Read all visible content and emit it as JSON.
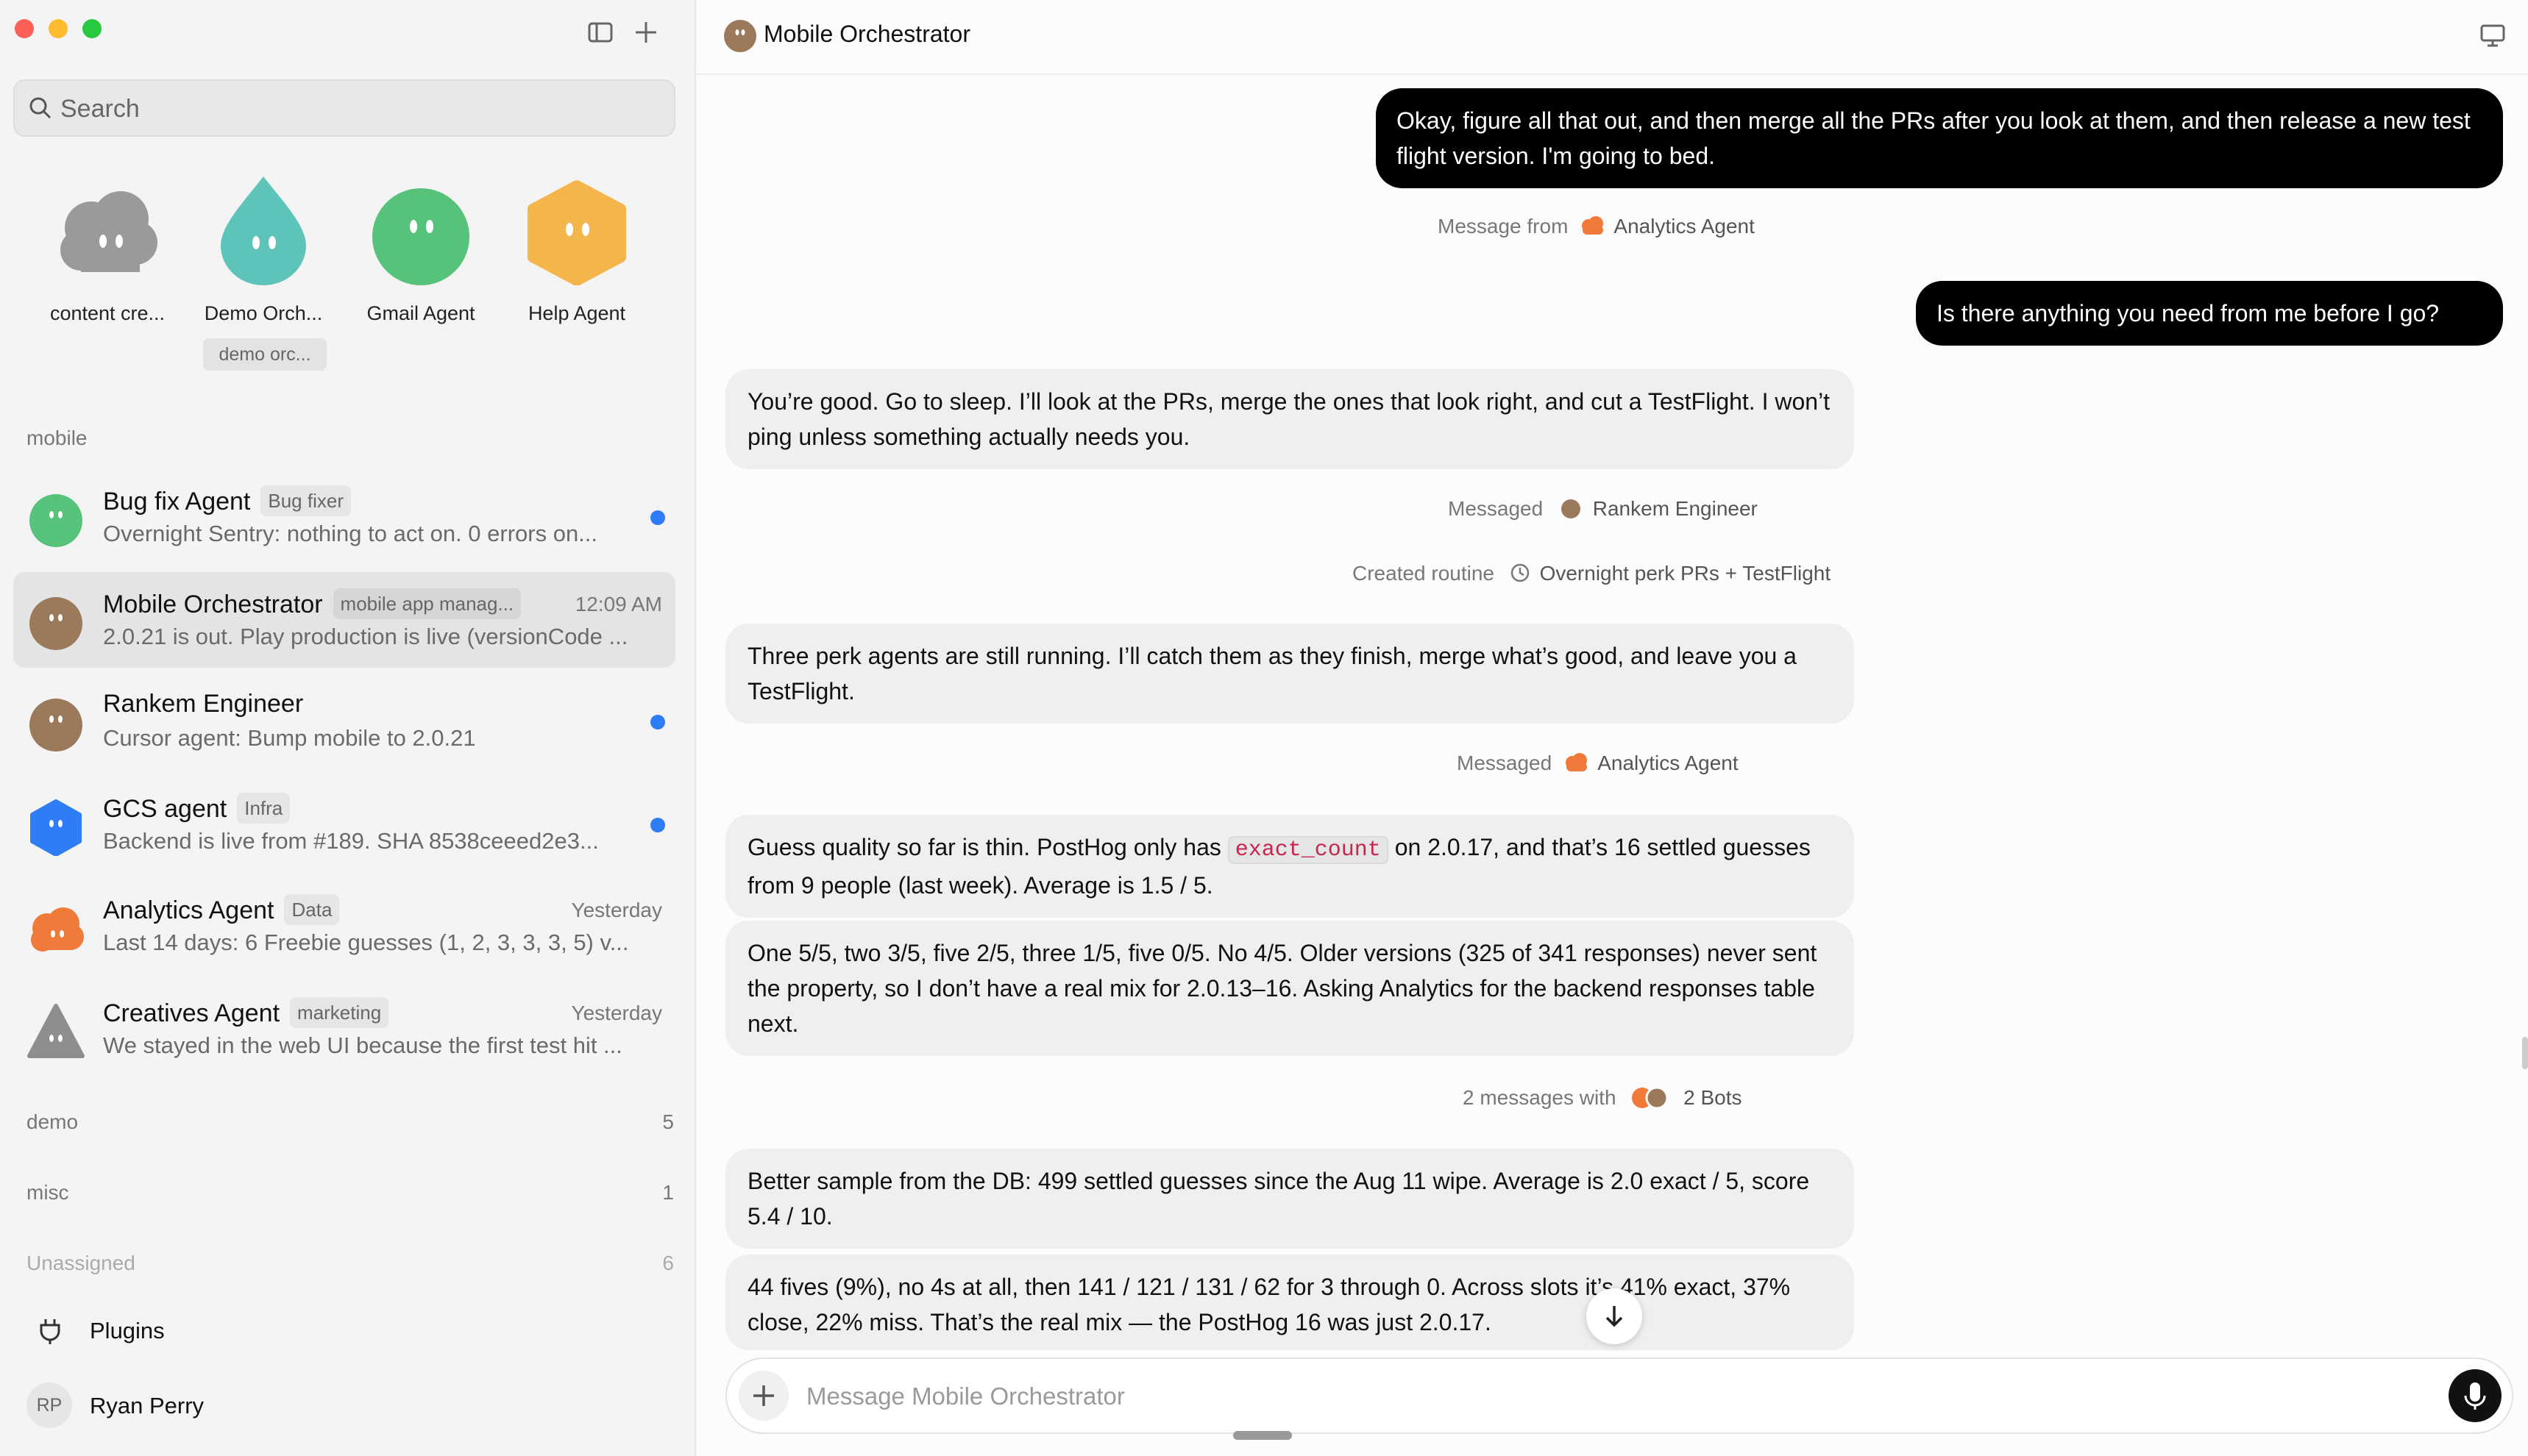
{
  "sidebar": {
    "search": {
      "placeholder": "Search"
    },
    "pinned": [
      {
        "label": "content cre...",
        "icon": "gray-cloud-icon",
        "color": "#9a9a9a"
      },
      {
        "label": "Demo Orch...",
        "sublabel": "demo orc...",
        "icon": "teal-drop-icon",
        "color": "#5ec3b8"
      },
      {
        "label": "Gmail Agent",
        "icon": "green-circle-icon",
        "color": "#56c27a"
      },
      {
        "label": "Help Agent",
        "icon": "orange-hexagon-icon",
        "color": "#f4b54a"
      }
    ],
    "sections": {
      "mobile": "mobile",
      "demo": {
        "label": "demo",
        "count": "5"
      },
      "misc": {
        "label": "misc",
        "count": "1"
      },
      "unassigned": {
        "label": "Unassigned",
        "count": "6"
      }
    },
    "conversations": [
      {
        "name": "Bug fix Agent",
        "tag": "Bug fixer",
        "preview": "Overnight Sentry: nothing to act on. 0 errors on...",
        "time": "",
        "unread": true
      },
      {
        "name": "Mobile Orchestrator",
        "tag": "mobile app manag...",
        "preview": "2.0.21 is out. Play production is live (versionCode ...",
        "time": "12:09 AM",
        "unread": false
      },
      {
        "name": "Rankem Engineer",
        "tag": "",
        "preview": "Cursor agent: Bump mobile to 2.0.21",
        "time": "",
        "unread": true
      },
      {
        "name": "GCS agent",
        "tag": "Infra",
        "preview": "Backend is live from #189. SHA 8538ceeed2e3...",
        "time": "",
        "unread": true
      },
      {
        "name": "Analytics Agent",
        "tag": "Data",
        "preview": "Last 14 days: 6 Freebie guesses (1, 2, 3, 3, 3, 5) v...",
        "time": "Yesterday",
        "unread": false
      },
      {
        "name": "Creatives Agent",
        "tag": "marketing",
        "preview": "We stayed in the web UI because the first test hit ...",
        "time": "Yesterday",
        "unread": false
      }
    ],
    "footer": {
      "plugins": "Plugins",
      "user_initials": "RP",
      "user_name": "Ryan Perry"
    }
  },
  "header": {
    "title": "Mobile Orchestrator"
  },
  "messages": {
    "user1": "Okay, figure all that out, and then merge all the PRs after you look at them, and then release a new test flight version. I'm going to bed.",
    "sys1_prefix": "Message from",
    "sys1_who": "Analytics Agent",
    "user2": "Is there anything you need from me before I go?",
    "bot1": "You’re good. Go to sleep. I’ll look at the PRs, merge the ones that look right, and cut a TestFlight. I won’t ping unless something actually needs you.",
    "sys2_prefix": "Messaged",
    "sys2_who": "Rankem Engineer",
    "sys3_prefix": "Created routine",
    "sys3_who": "Overnight perk PRs + TestFlight",
    "bot2": "Three perk agents are still running. I’ll catch them as they finish, merge what’s good, and leave you a TestFlight.",
    "sys4_prefix": "Messaged",
    "sys4_who": "Analytics Agent",
    "bot3_a": "Guess quality so far is thin. PostHog only has",
    "bot3_code": "exact_count",
    "bot3_b": "on 2.0.17, and that’s 16 settled guesses from 9 people (last week). Average is 1.5 / 5.",
    "bot4": "One 5/5, two 3/5, five 2/5, three 1/5, five 0/5. No 4/5. Older versions (325 of 341 responses) never sent the property, so I don’t have a real mix for 2.0.13–16. Asking Analytics for the backend responses table next.",
    "sys5_prefix": "2 messages with",
    "sys5_who": "2 Bots",
    "bot5": "Better sample from the DB: 499 settled guesses since the Aug 11 wipe. Average is 2.0 exact / 5, score 5.4 / 10.",
    "bot6": "44 fives (9%), no 4s at all, then 141 / 121 / 131 / 62 for 3 through 0. Across slots it’s 41% exact, 37% close, 22% miss. That’s the real mix — the PostHog 16 was just 2.0.17."
  },
  "composer": {
    "placeholder": "Message Mobile Orchestrator"
  },
  "colors": {
    "accent": "#2f7df6",
    "user_bubble": "#000000",
    "bot_bubble": "#efefef",
    "orchestrator": "#9b7a5c",
    "analytics": "#f07a3a"
  }
}
